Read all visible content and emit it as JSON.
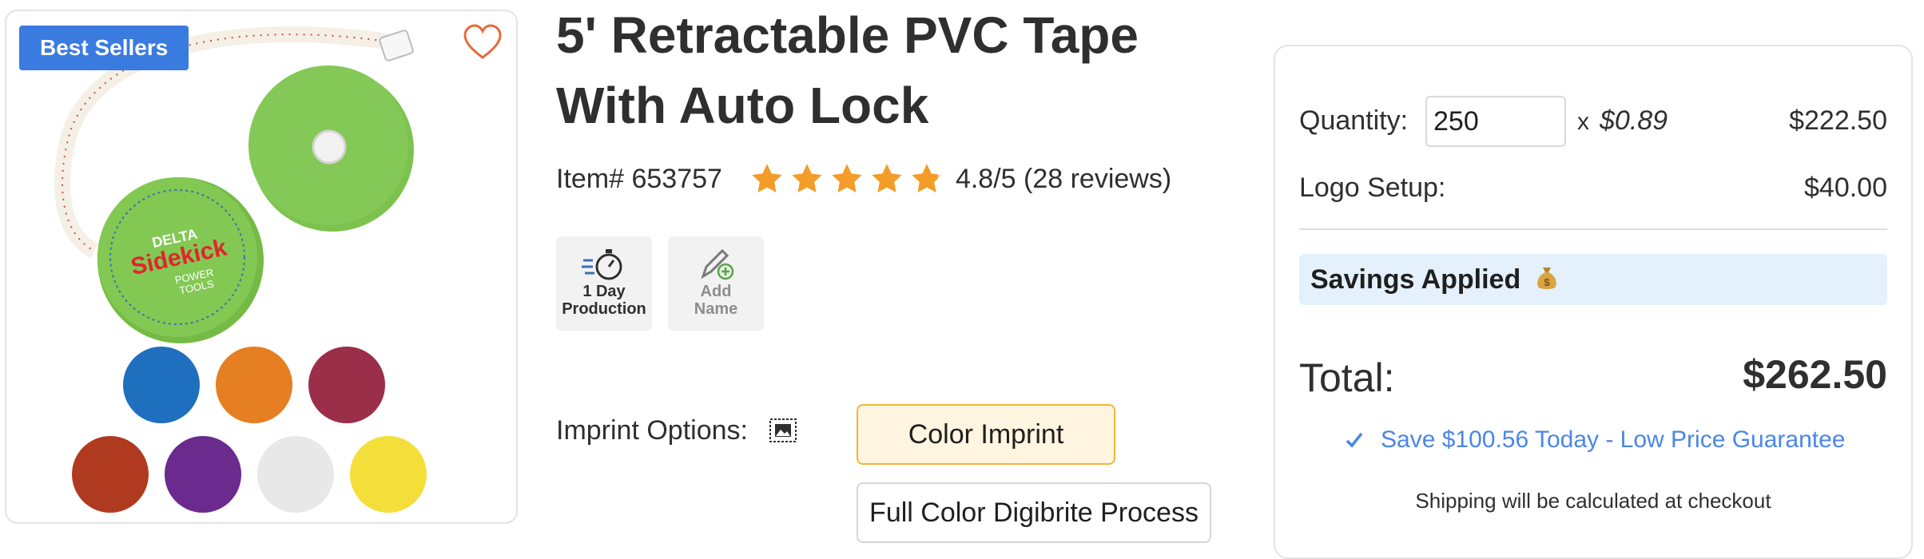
{
  "image_card": {
    "badge": "Best Sellers",
    "heart_icon": "heart-outline-icon",
    "logo_text": {
      "brand": "DELTA",
      "product": "Sidekick",
      "sub1": "POWER",
      "sub2": "TOOLS"
    },
    "colors": [
      "#1f6fbf",
      "#e67e22",
      "#9b2e49",
      "#b03a20",
      "#6a2a8e",
      "#e8e8e8",
      "#f4de3a",
      "#7cc24d"
    ]
  },
  "product": {
    "title": "5' Retractable PVC Tape With Auto Lock",
    "item_no": "Item# 653757",
    "rating_text": "4.8/5 (28 reviews)",
    "rating_value": 4.8,
    "rating_max": 5
  },
  "features": [
    {
      "label_line1": "1 Day",
      "label_line2": "Production",
      "icon": "stopwatch-icon"
    },
    {
      "label_line1": "Add",
      "label_line2": "Name",
      "icon": "pen-add-icon"
    }
  ],
  "imprint": {
    "label": "Imprint Options:",
    "icon": "image-icon",
    "options": [
      "Color Imprint",
      "Full Color Digibrite Process"
    ],
    "selected": "Color Imprint"
  },
  "pricing": {
    "quantity_label": "Quantity:",
    "quantity_value": "250",
    "times": "x",
    "unit_price": "$0.89",
    "line_total": "$222.50",
    "setup_label": "Logo Setup:",
    "setup_price": "$40.00",
    "savings_label": "Savings Applied",
    "savings_icon": "money-bag-icon",
    "total_label": "Total:",
    "total_value": "$262.50",
    "guarantee": "Save $100.56 Today - Low Price Guarantee",
    "shipping_note": "Shipping will be calculated at checkout"
  }
}
